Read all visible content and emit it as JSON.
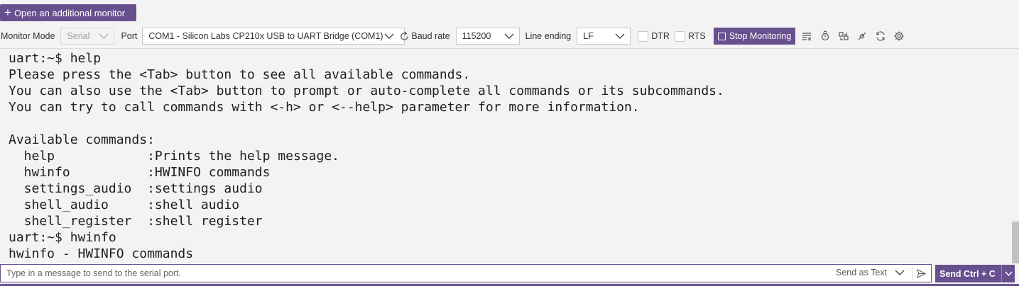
{
  "top": {
    "open_monitor_label": "Open an additional monitor"
  },
  "toolbar": {
    "monitor_mode_label": "Monitor Mode",
    "monitor_mode_value": "Serial",
    "port_label": "Port",
    "port_value": "COM1 - Silicon Labs CP210x USB to UART Bridge (COM1)",
    "baud_label": "Baud rate",
    "baud_value": "115200",
    "line_ending_label": "Line ending",
    "line_ending_value": "LF",
    "dtr_label": "DTR",
    "rts_label": "RTS",
    "stop_label": "Stop Monitoring",
    "icons": [
      "clear-output-icon",
      "timestamp-icon",
      "toggle-hex-icon",
      "connection-icon",
      "restart-icon",
      "settings-icon"
    ]
  },
  "terminal": {
    "lines": [
      "uart:~$ help",
      "Please press the <Tab> button to see all available commands.",
      "You can also use the <Tab> button to prompt or auto-complete all commands or its subcommands.",
      "You can try to call commands with <-h> or <--help> parameter for more information.",
      "",
      "Available commands:",
      "  help            :Prints the help message.",
      "  hwinfo          :HWINFO commands",
      "  settings_audio  :settings audio",
      "  shell_audio     :shell audio",
      "  shell_register  :shell register",
      "uart:~$ hwinfo",
      "hwinfo - HWINFO commands"
    ]
  },
  "send": {
    "placeholder": "Type in a message to send to the serial port.",
    "send_as_label": "Send as Text",
    "send_ctrl_label": "Send Ctrl + C"
  },
  "colors": {
    "accent": "#68508f",
    "background": "#f3f3f3"
  }
}
